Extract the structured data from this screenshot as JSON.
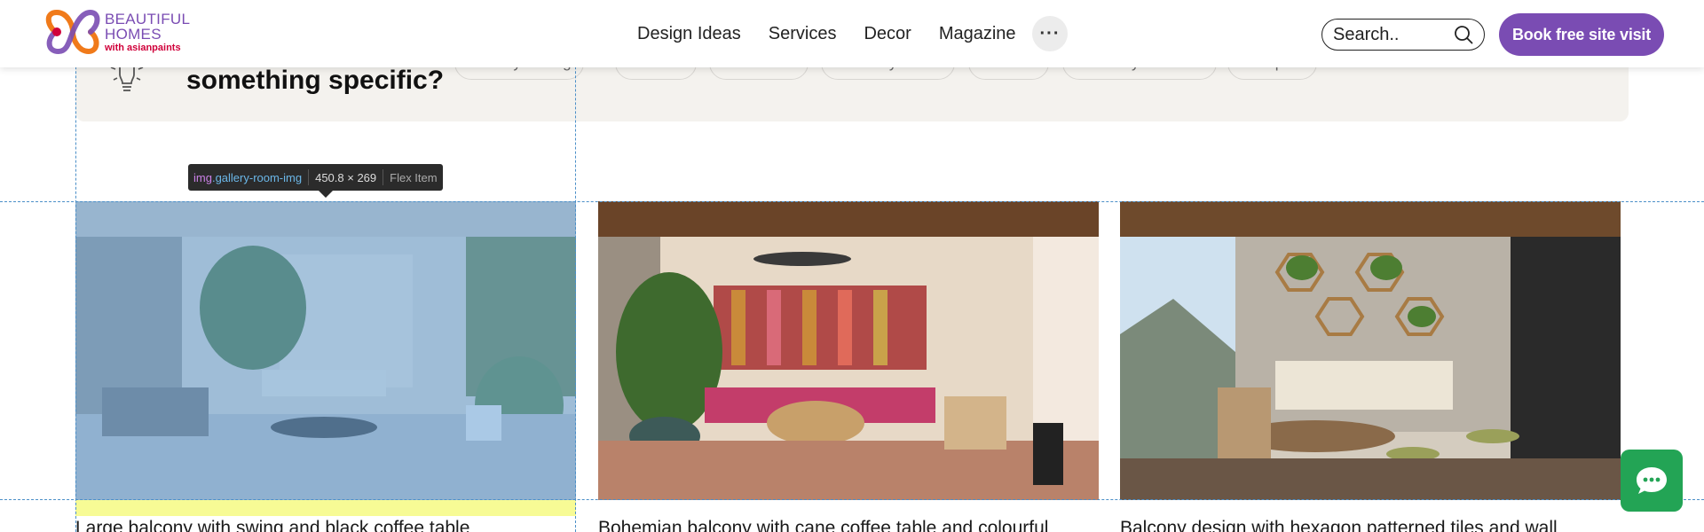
{
  "header": {
    "logo": {
      "line1": "BEAUTIFUL",
      "line2": "HOMES",
      "line3": "with asianpaints"
    },
    "nav": [
      "Design Ideas",
      "Services",
      "Decor",
      "Magazine"
    ],
    "more_label": "···",
    "search": {
      "placeholder": "Search..",
      "icon": "search-icon"
    },
    "cta_label": "Book free site visit"
  },
  "filters": {
    "title": "something specific?",
    "chips": [
      "Balcony Railing",
      "Glass",
      "Modern",
      "Balcony Roof",
      "Small",
      "Balcony Garden",
      "Simple"
    ]
  },
  "gallery": [
    {
      "caption": "Large balcony with swing and black coffee table"
    },
    {
      "caption": "Bohemian balcony with cane coffee table and colourful"
    },
    {
      "caption": "Balcony design with hexagon patterned tiles and wall"
    }
  ],
  "devtools": {
    "tag": "img",
    "class": ".gallery-room-img",
    "size": "450.8 × 269",
    "badge": "Flex Item"
  },
  "colors": {
    "brand": "#7a4cb3",
    "logo_accent": "#d0003a",
    "chat": "#23a455",
    "highlight": "#6fa8dc"
  }
}
